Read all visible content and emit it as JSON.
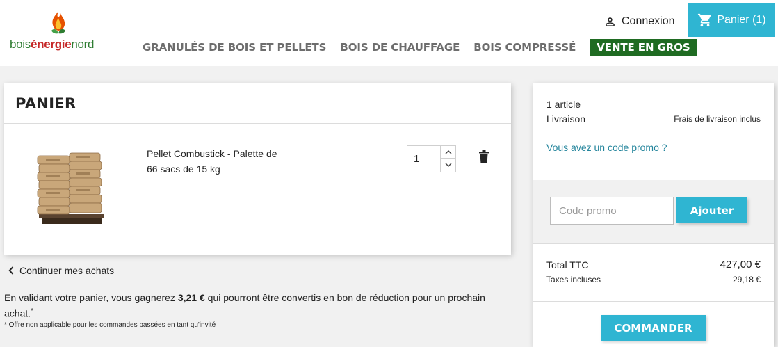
{
  "header": {
    "logo": {
      "part1": "bois",
      "part2": "énergie",
      "part3": "nord"
    },
    "nav": [
      {
        "label": "GRANULÉS DE BOIS ET PELLETS"
      },
      {
        "label": "BOIS DE CHAUFFAGE"
      },
      {
        "label": "BOIS COMPRESSÉ"
      },
      {
        "label": "VENTE EN GROS"
      }
    ],
    "login_label": "Connexion",
    "cart_label": "Panier (1)",
    "login_icon": "user-icon",
    "cart_icon": "shopping-cart-icon"
  },
  "cart": {
    "title": "PANIER",
    "items": [
      {
        "name_line1": "Pellet Combustick - Palette de",
        "name_line2": "66 sacs de 15 kg",
        "quantity": "1",
        "image_icon": "pellet-pallet-image",
        "delete_icon": "trash-icon"
      }
    ],
    "continue_label": "Continuer mes achats",
    "loyalty": {
      "text_before": "En validant votre panier, vous gagnerez ",
      "amount": "3,21 €",
      "text_after": " qui pourront être convertis en bon de réduction pour un prochain achat.",
      "asterisk": "*"
    },
    "note": "* Offre non applicable pour les commandes passées en tant qu'invité"
  },
  "summary": {
    "articles": "1 article",
    "shipping_label": "Livraison",
    "shipping_value": "Frais de livraison inclus",
    "promo_link": "Vous avez un code promo ?",
    "promo_placeholder": "Code promo",
    "promo_button": "Ajouter",
    "total_label": "Total TTC",
    "total_value": "427,00 €",
    "tax_label": "Taxes incluses",
    "tax_value": "29,18 €",
    "order_button": "COMMANDER"
  },
  "colors": {
    "accent": "#2fb5d2",
    "brand_green": "#1f6b22",
    "brand_red": "#c62828",
    "background": "#f1f1f1"
  }
}
